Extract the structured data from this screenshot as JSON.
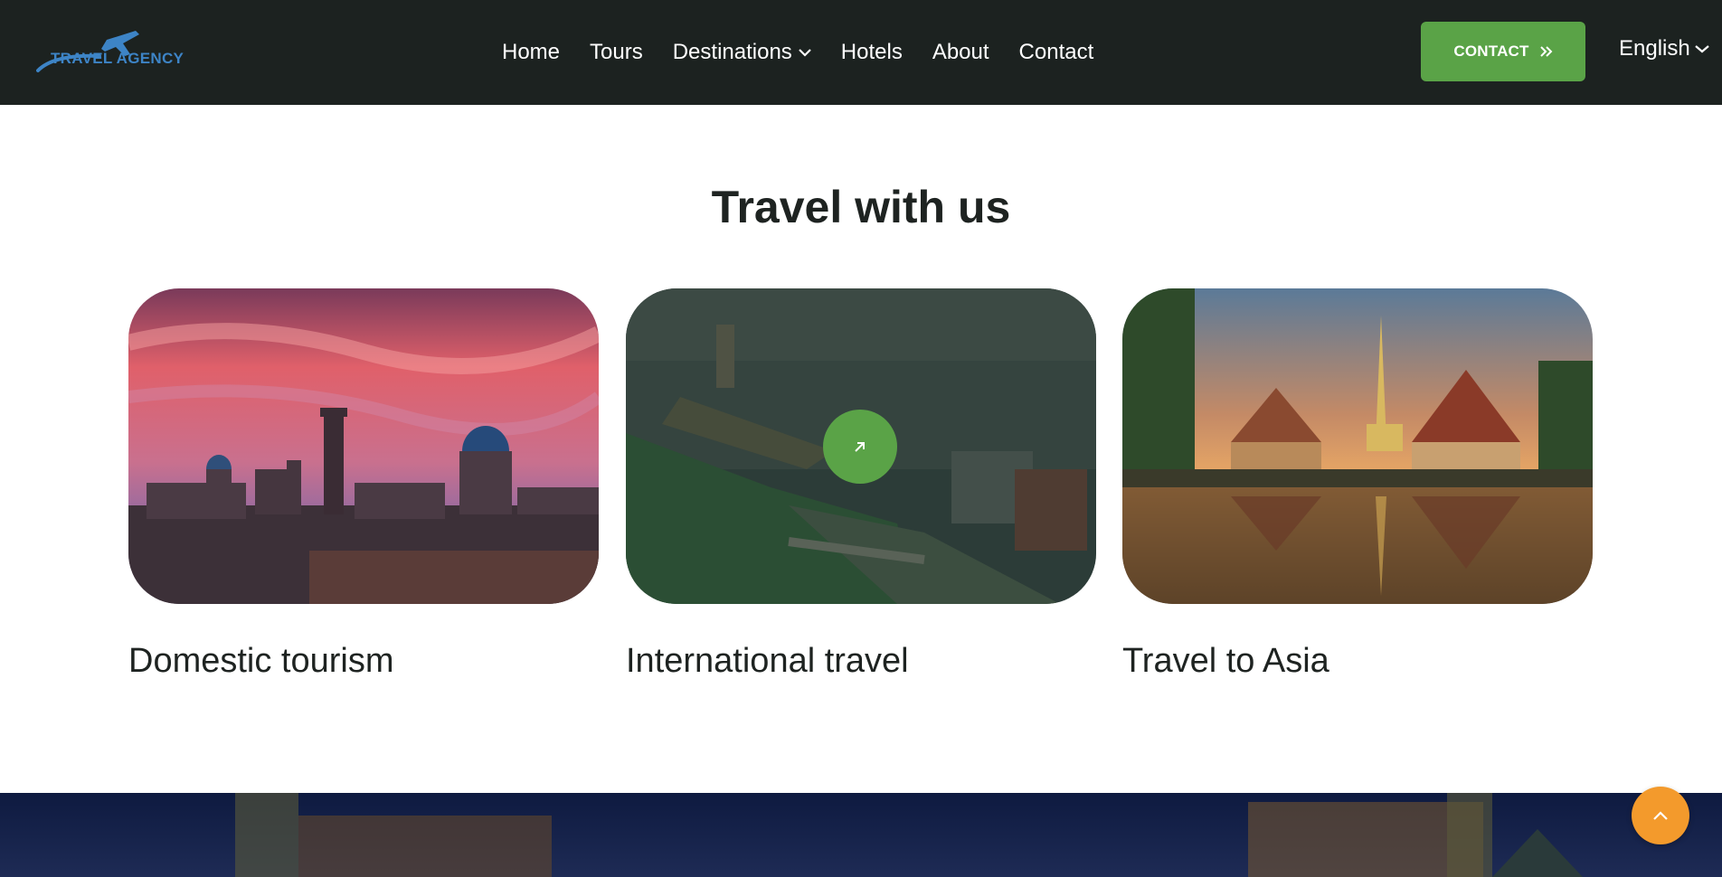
{
  "header": {
    "logo_text": "TRAVEL AGENCY",
    "nav": [
      "Home",
      "Tours",
      "Destinations",
      "Hotels",
      "About",
      "Contact"
    ],
    "contact_button": "CONTACT",
    "language": "English"
  },
  "section": {
    "title": "Travel with us",
    "cards": [
      {
        "title": "Domestic tourism",
        "image": "bukhara-skyline-sunset"
      },
      {
        "title": "International travel",
        "image": "london-westminster-aerial"
      },
      {
        "title": "Travel to Asia",
        "image": "thai-temple-reflection"
      }
    ]
  },
  "icons": {
    "destinations_dropdown": "chevron-down-icon",
    "language_dropdown": "chevron-down-icon",
    "contact_button": "double-chevron-right-icon",
    "card_link": "arrow-up-right-icon",
    "scroll_top": "chevron-up-icon"
  },
  "colors": {
    "header_bg": "#1c2220",
    "accent_green": "#5aa347",
    "logo_blue": "#3d84c6",
    "scroll_top": "#f39a2c",
    "text_dark": "#1e2321"
  }
}
